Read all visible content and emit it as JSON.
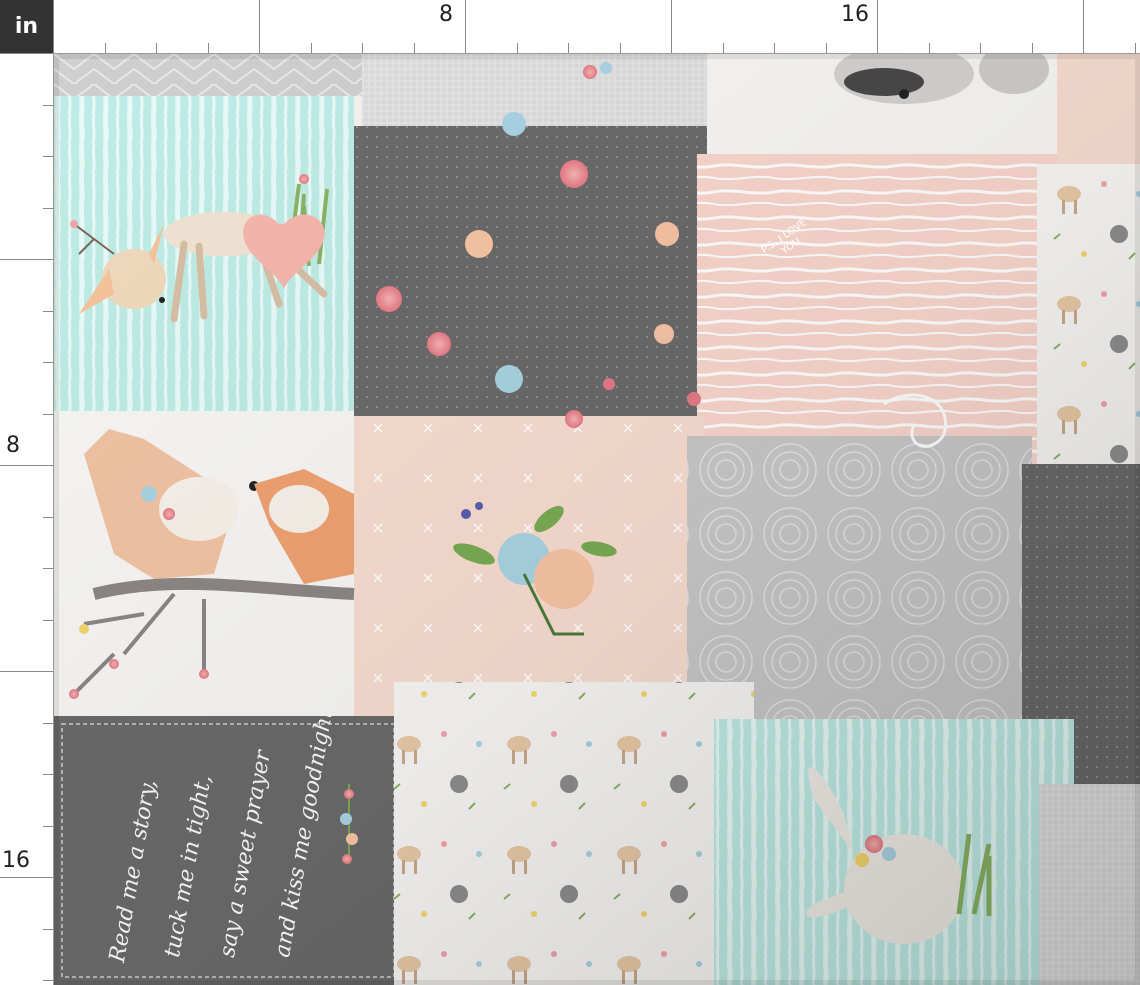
{
  "ruler": {
    "unit": "in",
    "top_labels": [
      "8",
      "16"
    ],
    "left_labels": [
      "8",
      "16"
    ]
  },
  "quote": {
    "lines": [
      "Read me a story,",
      "tuck me in tight,",
      "say a sweet prayer",
      "and kiss me goodnight."
    ]
  },
  "heart_text": "P.S. I LOVE YOU",
  "colors": {
    "mint": "#bfece6",
    "charcoal": "#6b6a6a",
    "blush": "#f9d6cc",
    "peach": "#f8ddd0",
    "light_gray": "#c9c8c8",
    "white": "#f7f6f4"
  }
}
